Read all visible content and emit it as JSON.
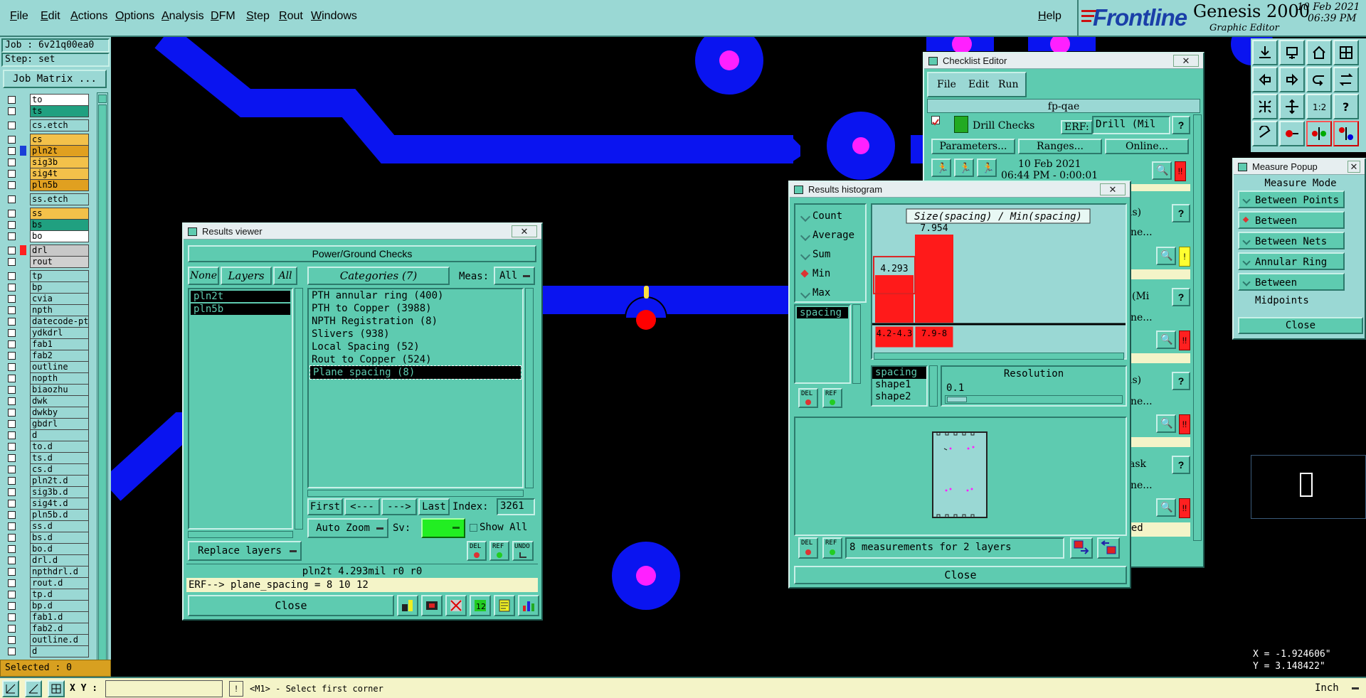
{
  "menubar": {
    "items": [
      "File",
      "Edit",
      "Actions",
      "Options",
      "Analysis",
      "DFM",
      "Step",
      "Rout",
      "Windows"
    ],
    "help": "Help"
  },
  "logo": {
    "brand": "Frontline",
    "product": "Genesis 2000",
    "subtitle": "Graphic Editor",
    "date": "10 Feb 2021",
    "time": "06:39 PM",
    "brand_color": "#1a3fa8",
    "accent_color": "#cc1111"
  },
  "job": {
    "job_label": "Job : 6v21q00ea0",
    "step_label": "Step: set",
    "matrix_button": "Job Matrix ..."
  },
  "layers": [
    {
      "name": "to",
      "color": "#ffffff"
    },
    {
      "name": "ts",
      "color": "#20a080"
    },
    {
      "name": "cs.etch",
      "color": "#9ad8d4"
    },
    {
      "name": "cs",
      "color": "#f3c14a"
    },
    {
      "name": "pln2t",
      "color": "#e0a020",
      "active": true
    },
    {
      "name": "sig3b",
      "color": "#f3c14a"
    },
    {
      "name": "sig4t",
      "color": "#f3c14a"
    },
    {
      "name": "pln5b",
      "color": "#e0a020"
    },
    {
      "name": "ss.etch",
      "color": "#9ad8d4"
    },
    {
      "name": "ss",
      "color": "#f3c14a"
    },
    {
      "name": "bs",
      "color": "#20a080"
    },
    {
      "name": "bo",
      "color": "#ffffff"
    },
    {
      "name": "drl",
      "color": "#c8c8c8"
    },
    {
      "name": "rout",
      "color": "#d0d0d0"
    },
    {
      "name": "tp",
      "color": "#9ad8d4"
    },
    {
      "name": "bp",
      "color": "#9ad8d4"
    },
    {
      "name": "cvia",
      "color": "#9ad8d4"
    },
    {
      "name": "npth",
      "color": "#9ad8d4"
    },
    {
      "name": "datecode-pth",
      "color": "#9ad8d4"
    },
    {
      "name": "ydkdrl",
      "color": "#9ad8d4"
    },
    {
      "name": "fab1",
      "color": "#9ad8d4"
    },
    {
      "name": "fab2",
      "color": "#9ad8d4"
    },
    {
      "name": "outline",
      "color": "#9ad8d4"
    },
    {
      "name": "nopth",
      "color": "#9ad8d4"
    },
    {
      "name": "biaozhu",
      "color": "#9ad8d4"
    },
    {
      "name": "dwk",
      "color": "#9ad8d4"
    },
    {
      "name": "dwkby",
      "color": "#9ad8d4"
    },
    {
      "name": "gbdrl",
      "color": "#9ad8d4"
    },
    {
      "name": "d",
      "color": "#9ad8d4"
    },
    {
      "name": "to.d",
      "color": "#9ad8d4"
    },
    {
      "name": "ts.d",
      "color": "#9ad8d4"
    },
    {
      "name": "cs.d",
      "color": "#9ad8d4"
    },
    {
      "name": "pln2t.d",
      "color": "#9ad8d4"
    },
    {
      "name": "sig3b.d",
      "color": "#9ad8d4"
    },
    {
      "name": "sig4t.d",
      "color": "#9ad8d4"
    },
    {
      "name": "pln5b.d",
      "color": "#9ad8d4"
    },
    {
      "name": "ss.d",
      "color": "#9ad8d4"
    },
    {
      "name": "bs.d",
      "color": "#9ad8d4"
    },
    {
      "name": "bo.d",
      "color": "#9ad8d4"
    },
    {
      "name": "drl.d",
      "color": "#9ad8d4"
    },
    {
      "name": "npthdrl.d",
      "color": "#9ad8d4"
    },
    {
      "name": "rout.d",
      "color": "#9ad8d4"
    },
    {
      "name": "tp.d",
      "color": "#9ad8d4"
    },
    {
      "name": "bp.d",
      "color": "#9ad8d4"
    },
    {
      "name": "fab1.d",
      "color": "#9ad8d4"
    },
    {
      "name": "fab2.d",
      "color": "#9ad8d4"
    },
    {
      "name": "outline.d",
      "color": "#9ad8d4"
    },
    {
      "name": "d",
      "color": "#9ad8d4"
    }
  ],
  "selected_label": "Selected : 0",
  "statusbar": {
    "xy_label": "X Y :",
    "prompt": "<M1> - Select first corner",
    "units": "Inch"
  },
  "coords": {
    "x": "X = -1.924606\"",
    "y": "Y = 3.148422\""
  },
  "results_viewer": {
    "title": "Results viewer",
    "header": "Power/Ground Checks",
    "none_btn": "None",
    "layers_btn": "Layers",
    "all_btn": "All",
    "categories_btn": "Categories (7)",
    "meas_label": "Meas:",
    "meas_value": "All",
    "layers": [
      "pln2t",
      "pln5b"
    ],
    "categories": [
      "PTH annular ring (400)",
      "PTH to Copper (3988)",
      "NPTH Registration (8)",
      "Slivers (938)",
      "Local Spacing (52)",
      "Rout to Copper (524)",
      "Plane spacing (8)"
    ],
    "selected_category": 6,
    "first": "First",
    "prev": "<---",
    "next": "--->",
    "last": "Last",
    "index_label": "Index:",
    "index_value": "3261",
    "auto_zoom": "Auto Zoom",
    "sv_label": "Sv:",
    "show_all": "Show All",
    "replace_layers": "Replace layers",
    "del": "DEL",
    "ref": "REF",
    "undo": "UNDO",
    "info": "pln2t 4.293mil  r0  r0",
    "erf": "ERF--> plane_spacing = 8 10 12",
    "close": "Close"
  },
  "histogram": {
    "title": "Results histogram",
    "modes": [
      "Count",
      "Average",
      "Sum",
      "Min",
      "Max"
    ],
    "selected_mode": 3,
    "measure_list": [
      "spacing"
    ],
    "chart_title": "Size(spacing) / Min(spacing)",
    "bins": [
      {
        "label": "4.2-4.3",
        "value": 4.293
      },
      {
        "label": "7.9-8",
        "value": 7.954
      }
    ],
    "attrs": [
      "spacing",
      "shape1",
      "shape2"
    ],
    "resolution_label": "Resolution",
    "resolution_value": "0.1",
    "del": "DEL",
    "ref": "REF",
    "summary": "8 measurements for 2 layers",
    "close": "Close"
  },
  "checklist": {
    "title": "Checklist Editor",
    "menu": [
      "File",
      "Edit",
      "Run"
    ],
    "name": "fp-qae",
    "check_name": "Drill Checks",
    "erf_label": "ERF:",
    "erf_value": "Drill (Mil",
    "parameters": "Parameters...",
    "ranges": "Ranges...",
    "online": "Online...",
    "date": "10 Feb 2021",
    "time_line": "06:44 PM - 0:00:01",
    "partial_labels": [
      "ls)",
      "nline...",
      "(Mi",
      "nline...",
      "ls)",
      "nline...",
      "ask",
      "nline...",
      "ssed"
    ]
  },
  "measure": {
    "title": "Measure Popup",
    "header": "Measure Mode",
    "modes": [
      "Between Points",
      "Between Contours",
      "Between Nets",
      "Annular Ring",
      "Between Midpoints"
    ],
    "selected": 1,
    "close": "Close"
  },
  "colors": {
    "panel": "#5ecbb0",
    "panel_light": "#9ad8d4",
    "copper": "#0a14f0",
    "pad": "#ff20ff",
    "bar": "#ff1a1a",
    "drill_hit": "#ff0000"
  }
}
